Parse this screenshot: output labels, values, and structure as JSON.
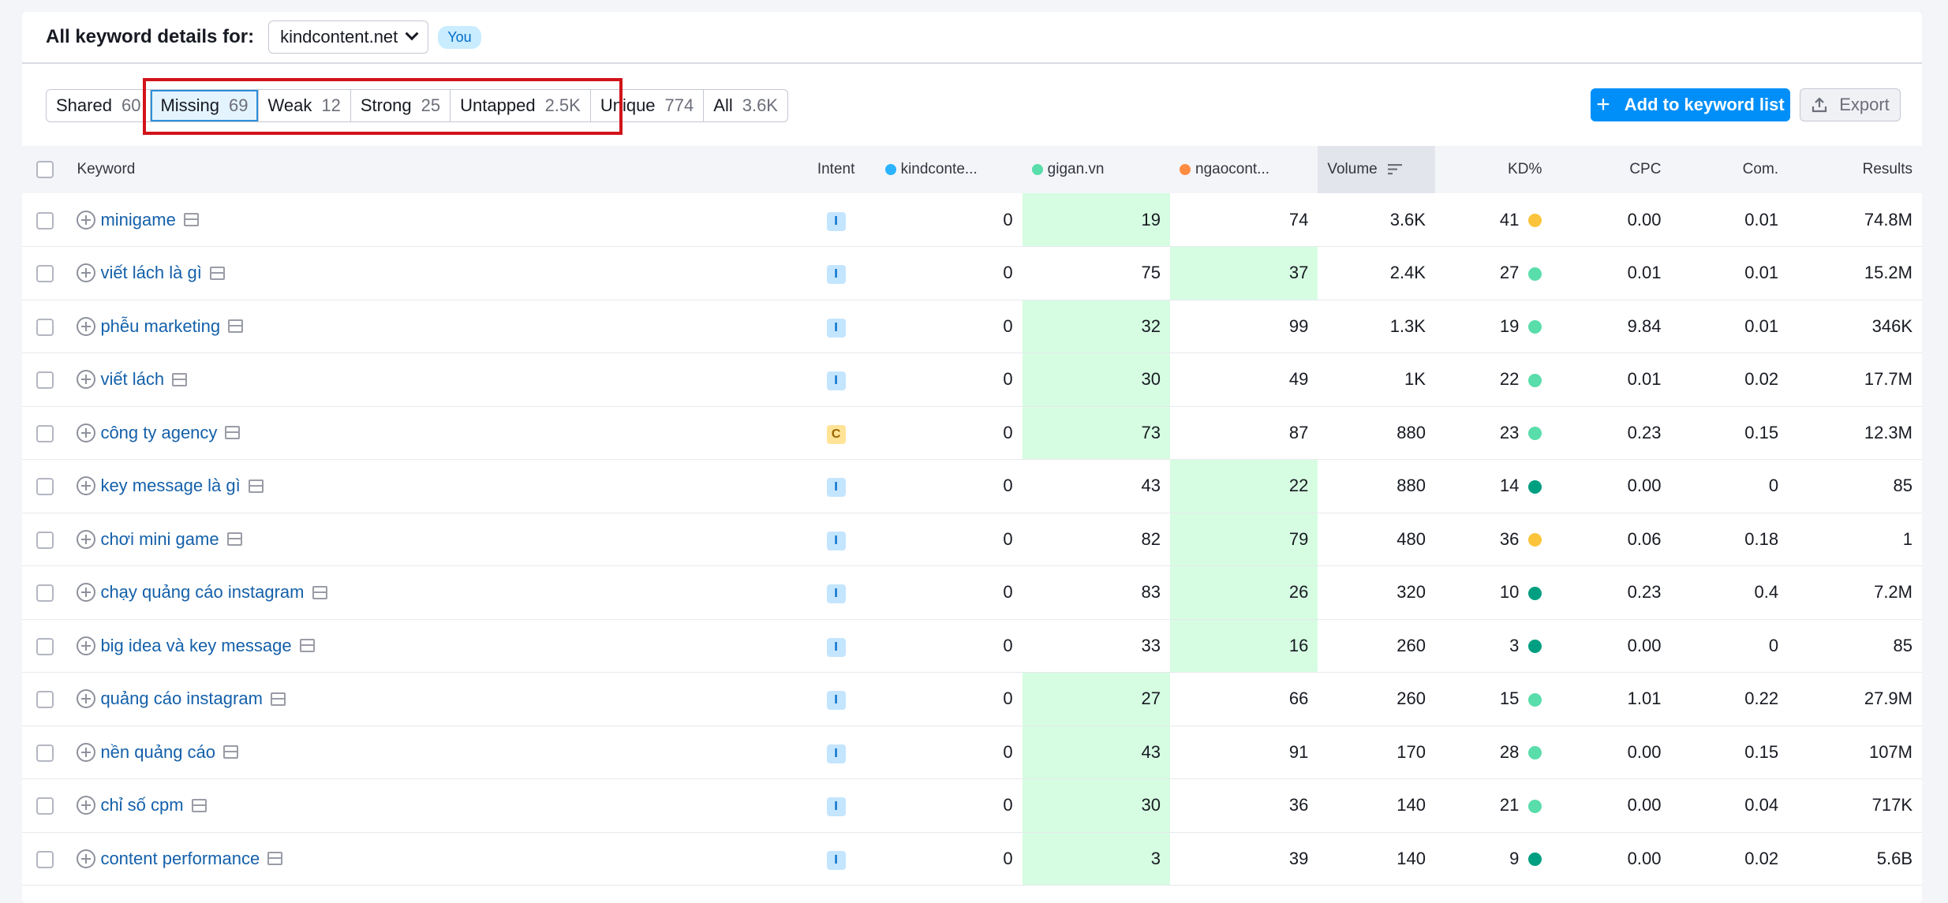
{
  "header": {
    "title": "All keyword details for:",
    "domain": "kindcontent.net",
    "badge": "You"
  },
  "tabs": [
    {
      "label": "Shared",
      "count": "60",
      "active": false
    },
    {
      "label": "Missing",
      "count": "69",
      "active": true
    },
    {
      "label": "Weak",
      "count": "12",
      "active": false
    },
    {
      "label": "Strong",
      "count": "25",
      "active": false
    },
    {
      "label": "Untapped",
      "count": "2.5K",
      "active": false
    },
    {
      "label": "Unique",
      "count": "774",
      "active": false
    },
    {
      "label": "All",
      "count": "3.6K",
      "active": false
    }
  ],
  "actions": {
    "add_label": "Add to keyword list",
    "export_label": "Export"
  },
  "columns": {
    "keyword": "Keyword",
    "intent": "Intent",
    "d1": "kindconte...",
    "d2": "gigan.vn",
    "d3": "ngaocont...",
    "volume": "Volume",
    "kd": "KD%",
    "cpc": "CPC",
    "com": "Com.",
    "results": "Results"
  },
  "colors": {
    "d1": "#2bb3ff",
    "d2": "#59ddaa",
    "d3": "#ff8c43",
    "kd_yellow": "#fbc43b",
    "kd_light_green": "#59ddaa",
    "kd_dark_green": "#009f81",
    "accent": "#008ff8",
    "highlight": "#d2131a"
  },
  "rows": [
    {
      "keyword": "minigame",
      "intent": "I",
      "d1": "0",
      "d2": "19",
      "d3": "74",
      "best": "d2",
      "volume": "3.6K",
      "kd": "41",
      "kd_color": "#fbc43b",
      "cpc": "0.00",
      "com": "0.01",
      "results": "74.8M"
    },
    {
      "keyword": "viết lách là gì",
      "intent": "I",
      "d1": "0",
      "d2": "75",
      "d3": "37",
      "best": "d3",
      "volume": "2.4K",
      "kd": "27",
      "kd_color": "#59ddaa",
      "cpc": "0.01",
      "com": "0.01",
      "results": "15.2M"
    },
    {
      "keyword": "phễu marketing",
      "intent": "I",
      "d1": "0",
      "d2": "32",
      "d3": "99",
      "best": "d2",
      "volume": "1.3K",
      "kd": "19",
      "kd_color": "#59ddaa",
      "cpc": "9.84",
      "com": "0.01",
      "results": "346K"
    },
    {
      "keyword": "viết lách",
      "intent": "I",
      "d1": "0",
      "d2": "30",
      "d3": "49",
      "best": "d2",
      "volume": "1K",
      "kd": "22",
      "kd_color": "#59ddaa",
      "cpc": "0.01",
      "com": "0.02",
      "results": "17.7M"
    },
    {
      "keyword": "công ty agency",
      "intent": "C",
      "d1": "0",
      "d2": "73",
      "d3": "87",
      "best": "d2",
      "volume": "880",
      "kd": "23",
      "kd_color": "#59ddaa",
      "cpc": "0.23",
      "com": "0.15",
      "results": "12.3M"
    },
    {
      "keyword": "key message là gì",
      "intent": "I",
      "d1": "0",
      "d2": "43",
      "d3": "22",
      "best": "d3",
      "volume": "880",
      "kd": "14",
      "kd_color": "#009f81",
      "cpc": "0.00",
      "com": "0",
      "results": "85"
    },
    {
      "keyword": "chơi mini game",
      "intent": "I",
      "d1": "0",
      "d2": "82",
      "d3": "79",
      "best": "d3",
      "volume": "480",
      "kd": "36",
      "kd_color": "#fbc43b",
      "cpc": "0.06",
      "com": "0.18",
      "results": "1"
    },
    {
      "keyword": "chạy quảng cáo instagram",
      "intent": "I",
      "d1": "0",
      "d2": "83",
      "d3": "26",
      "best": "d3",
      "volume": "320",
      "kd": "10",
      "kd_color": "#009f81",
      "cpc": "0.23",
      "com": "0.4",
      "results": "7.2M"
    },
    {
      "keyword": "big idea và key message",
      "intent": "I",
      "d1": "0",
      "d2": "33",
      "d3": "16",
      "best": "d3",
      "volume": "260",
      "kd": "3",
      "kd_color": "#009f81",
      "cpc": "0.00",
      "com": "0",
      "results": "85"
    },
    {
      "keyword": "quảng cáo instagram",
      "intent": "I",
      "d1": "0",
      "d2": "27",
      "d3": "66",
      "best": "d2",
      "volume": "260",
      "kd": "15",
      "kd_color": "#59ddaa",
      "cpc": "1.01",
      "com": "0.22",
      "results": "27.9M"
    },
    {
      "keyword": "nền quảng cáo",
      "intent": "I",
      "d1": "0",
      "d2": "43",
      "d3": "91",
      "best": "d2",
      "volume": "170",
      "kd": "28",
      "kd_color": "#59ddaa",
      "cpc": "0.00",
      "com": "0.15",
      "results": "107M"
    },
    {
      "keyword": "chỉ số cpm",
      "intent": "I",
      "d1": "0",
      "d2": "30",
      "d3": "36",
      "best": "d2",
      "volume": "140",
      "kd": "21",
      "kd_color": "#59ddaa",
      "cpc": "0.00",
      "com": "0.04",
      "results": "717K"
    },
    {
      "keyword": "content performance",
      "intent": "I",
      "d1": "0",
      "d2": "3",
      "d3": "39",
      "best": "d2",
      "volume": "140",
      "kd": "9",
      "kd_color": "#009f81",
      "cpc": "0.00",
      "com": "0.02",
      "results": "5.6B"
    }
  ]
}
